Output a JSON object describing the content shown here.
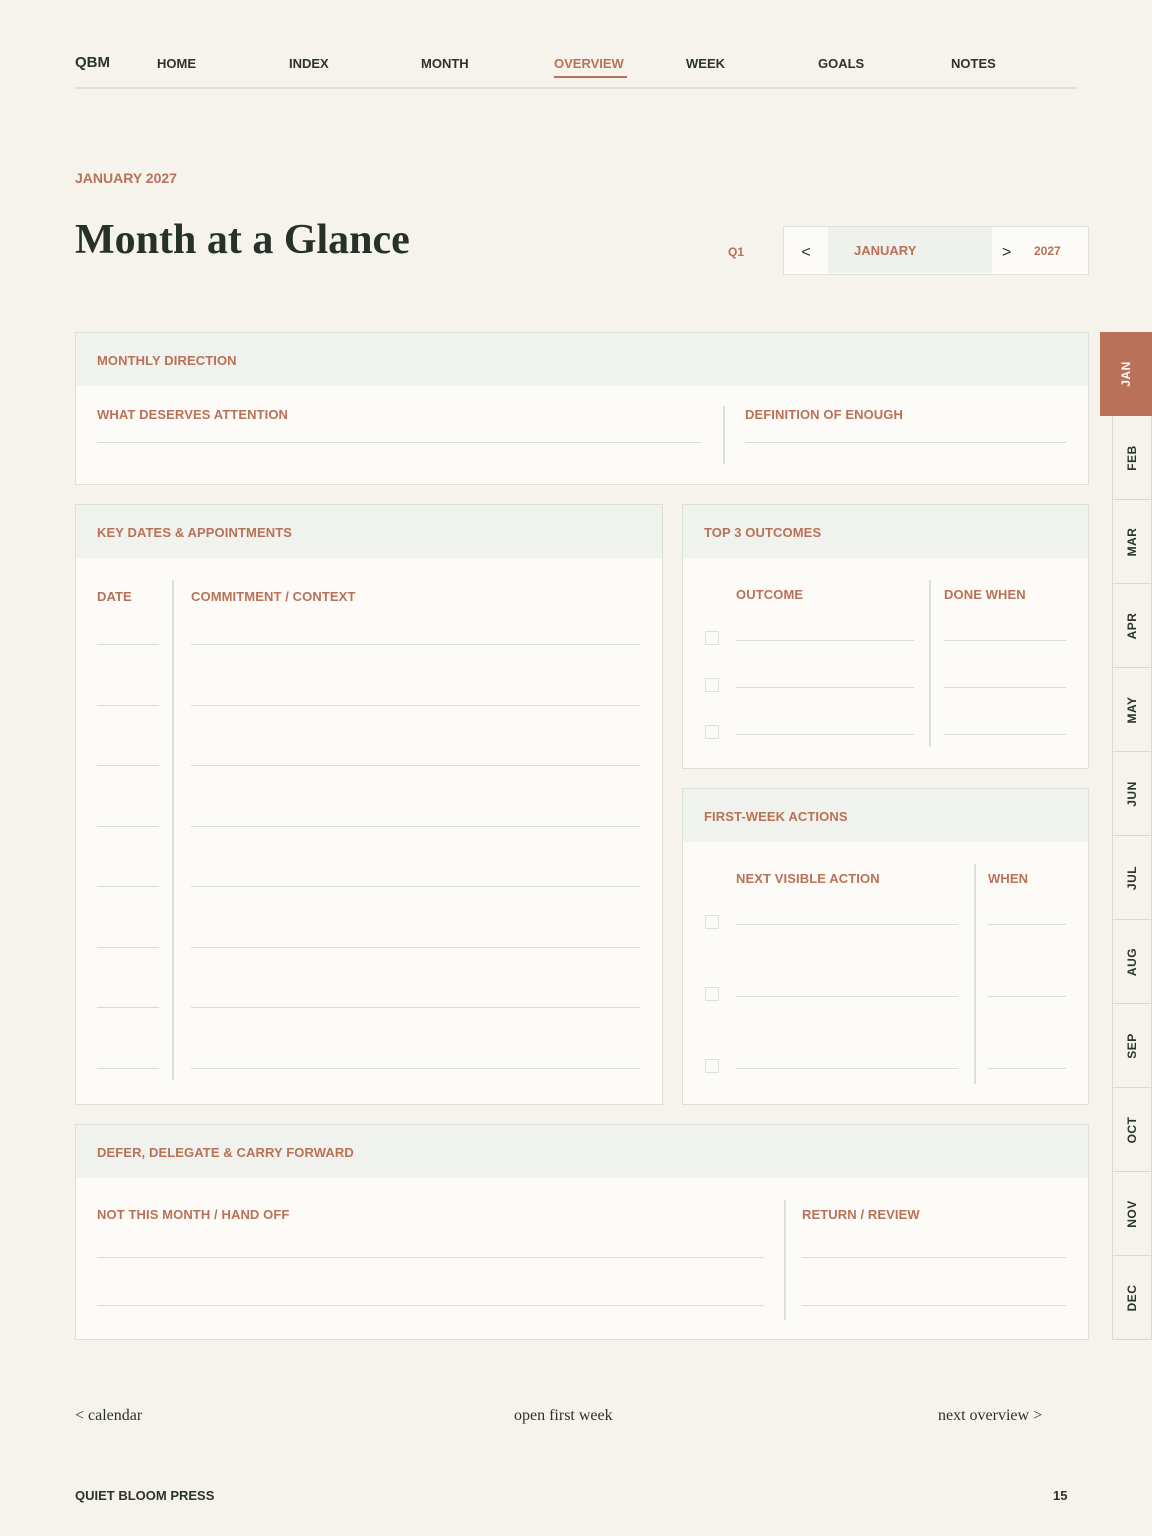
{
  "nav": {
    "brand": "QBM",
    "items": [
      {
        "label": "HOME"
      },
      {
        "label": "INDEX"
      },
      {
        "label": "MONTH"
      },
      {
        "label": "OVERVIEW",
        "active": true
      },
      {
        "label": "WEEK"
      },
      {
        "label": "GOALS"
      },
      {
        "label": "NOTES"
      }
    ]
  },
  "header": {
    "eyebrow": "JANUARY 2027",
    "title": "Month at a Glance",
    "quarter": "Q1",
    "picker": {
      "prev": "<",
      "month": "JANUARY",
      "next": ">",
      "year": "2027"
    }
  },
  "monthly_direction": {
    "title": "MONTHLY DIRECTION",
    "left_label": "WHAT DESERVES ATTENTION",
    "right_label": "DEFINITION OF ENOUGH"
  },
  "key_dates": {
    "title": "KEY DATES & APPOINTMENTS",
    "col_date": "DATE",
    "col_commitment": "COMMITMENT / CONTEXT",
    "row_count": 8
  },
  "top_outcomes": {
    "title": "TOP 3 OUTCOMES",
    "col_outcome": "OUTCOME",
    "col_done": "DONE WHEN",
    "row_count": 3
  },
  "first_week": {
    "title": "FIRST-WEEK ACTIONS",
    "col_action": "NEXT VISIBLE ACTION",
    "col_when": "WHEN",
    "row_count": 3
  },
  "defer": {
    "title": "DEFER, DELEGATE & CARRY FORWARD",
    "left_label": "NOT THIS MONTH / HAND OFF",
    "right_label": "RETURN / REVIEW"
  },
  "month_tabs": [
    "JAN",
    "FEB",
    "MAR",
    "APR",
    "MAY",
    "JUN",
    "JUL",
    "AUG",
    "SEP",
    "OCT",
    "NOV",
    "DEC"
  ],
  "active_month": "JAN",
  "footer_links": {
    "calendar": "< calendar",
    "first_week": "open first week",
    "next": "next overview >"
  },
  "footer": {
    "publisher": "QUIET BLOOM PRESS",
    "page_number": "15"
  },
  "colors": {
    "accent": "#b97158",
    "background": "#f6f2ec",
    "card": "#fdfbf7",
    "card_header": "#f0f2ed",
    "text": "#2b332e"
  }
}
